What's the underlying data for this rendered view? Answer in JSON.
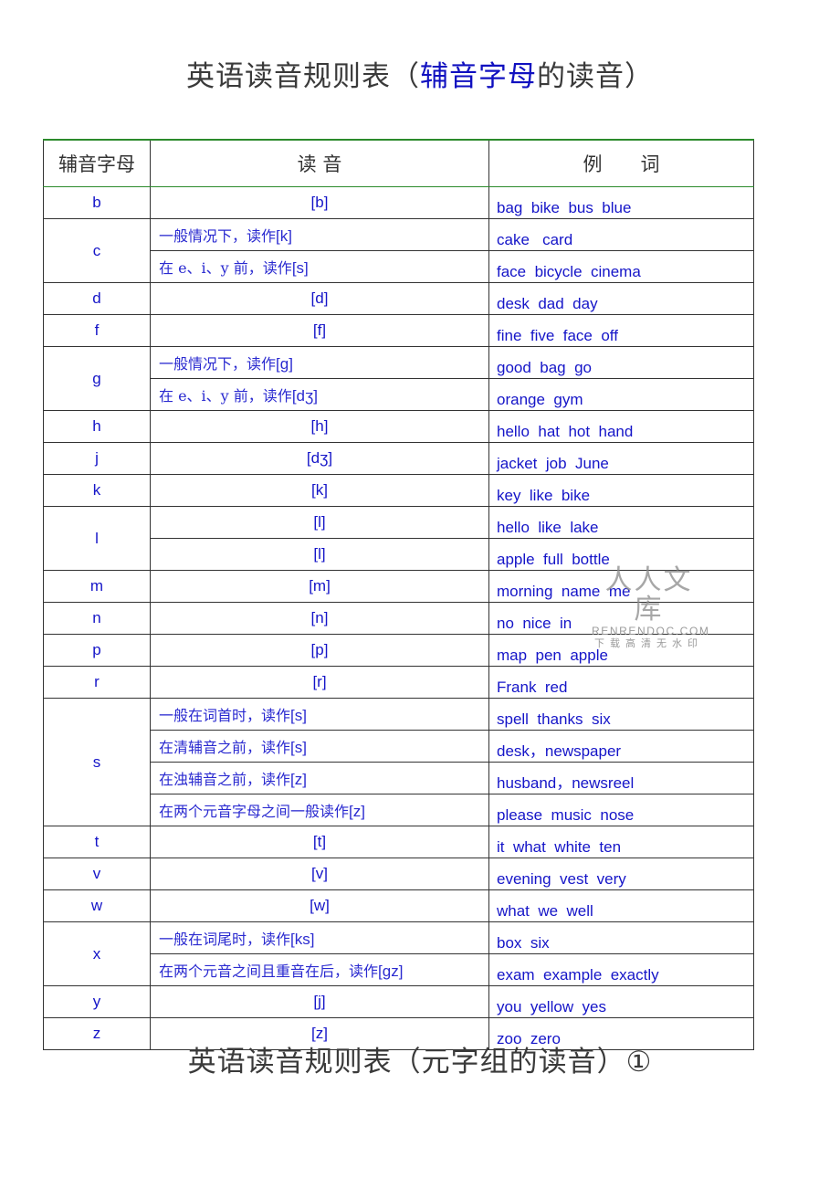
{
  "title1": {
    "prefix": "英语读音规则表（",
    "highlight": "辅音字母",
    "suffix": "的读音）"
  },
  "title2": "英语读音规则表（元字组的读音）①",
  "headers": {
    "letter": "辅音字母",
    "pron": "读 音",
    "examples": "例　　词"
  },
  "rows": [
    {
      "letter": "b",
      "items": [
        {
          "pron": "[b]",
          "examples": "bag  bike  bus  blue"
        }
      ]
    },
    {
      "letter": "c",
      "items": [
        {
          "rule": "一般情况下，读作",
          "ipa": "[k]",
          "examples": "cake   card"
        },
        {
          "rule": "在 e、i、y 前，读作",
          "ipa": "[s]",
          "examples": "face  bicycle  cinema"
        }
      ]
    },
    {
      "letter": "d",
      "items": [
        {
          "pron": "[d]",
          "examples": "desk  dad  day"
        }
      ]
    },
    {
      "letter": "f",
      "items": [
        {
          "pron": "[f]",
          "examples": "fine  five  face  off"
        }
      ]
    },
    {
      "letter": "g",
      "items": [
        {
          "rule": "一般情况下，读作",
          "ipa": "[g]",
          "examples": "good  bag  go"
        },
        {
          "rule": "在 e、i、y 前，读作",
          "ipa": "[dʒ]",
          "examples": "orange  gym"
        }
      ]
    },
    {
      "letter": "h",
      "items": [
        {
          "pron": "[h]",
          "examples": "hello  hat  hot  hand"
        }
      ]
    },
    {
      "letter": "j",
      "items": [
        {
          "pron": "[dʒ]",
          "examples": "jacket  job  June"
        }
      ]
    },
    {
      "letter": "k",
      "items": [
        {
          "pron": "[k]",
          "examples": "key  like  bike"
        }
      ]
    },
    {
      "letter": "l",
      "items": [
        {
          "pron": "[l]",
          "examples": "hello  like  lake"
        },
        {
          "pron": "[l]",
          "examples": "apple  full  bottle"
        }
      ]
    },
    {
      "letter": "m",
      "items": [
        {
          "pron": "[m]",
          "examples": "morning  name  me"
        }
      ]
    },
    {
      "letter": "n",
      "items": [
        {
          "pron": "[n]",
          "examples": "no  nice  in"
        }
      ]
    },
    {
      "letter": "p",
      "items": [
        {
          "pron": "[p]",
          "examples": "map  pen  apple"
        }
      ]
    },
    {
      "letter": "r",
      "items": [
        {
          "pron": "[r]",
          "examples": "Frank  red"
        }
      ]
    },
    {
      "letter": "s",
      "items": [
        {
          "rule": "一般在词首时，读作",
          "ipa": "[s]",
          "examples": "spell  thanks  six"
        },
        {
          "rule": "在清辅音之前，读作",
          "ipa": "[s]",
          "examples": "desk，newspaper"
        },
        {
          "rule": "在浊辅音之前，读作",
          "ipa": "[z]",
          "examples": "husband，newsreel"
        },
        {
          "rule": "在两个元音字母之间一般读作",
          "ipa": "[z]",
          "examples": "please  music  nose"
        }
      ]
    },
    {
      "letter": "t",
      "items": [
        {
          "pron": "[t]",
          "examples": "it  what  white  ten"
        }
      ]
    },
    {
      "letter": "v",
      "items": [
        {
          "pron": "[v]",
          "examples": "evening  vest  very"
        }
      ]
    },
    {
      "letter": "w",
      "items": [
        {
          "pron": "[w]",
          "examples": "what  we  well"
        }
      ]
    },
    {
      "letter": "x",
      "items": [
        {
          "rule": "一般在词尾时，读作",
          "ipa": "[ks]",
          "examples": "box  six"
        },
        {
          "rule": "在两个元音之间且重音在后，读作",
          "ipa": "[gz]",
          "examples": "exam  example  exactly"
        }
      ]
    },
    {
      "letter": "y",
      "items": [
        {
          "pron": "[j]",
          "examples": "you  yellow  yes"
        }
      ]
    },
    {
      "letter": "z",
      "items": [
        {
          "pron": "[z]",
          "examples": "zoo  zero"
        }
      ]
    }
  ],
  "watermark": {
    "big": "人人文库",
    "url": "RENRENDOC.COM",
    "sub": "下载高清无水印"
  },
  "colors": {
    "text_blue": "#1515c8",
    "header_rule": "#2b8a2b",
    "title": "#3a3a3a"
  }
}
